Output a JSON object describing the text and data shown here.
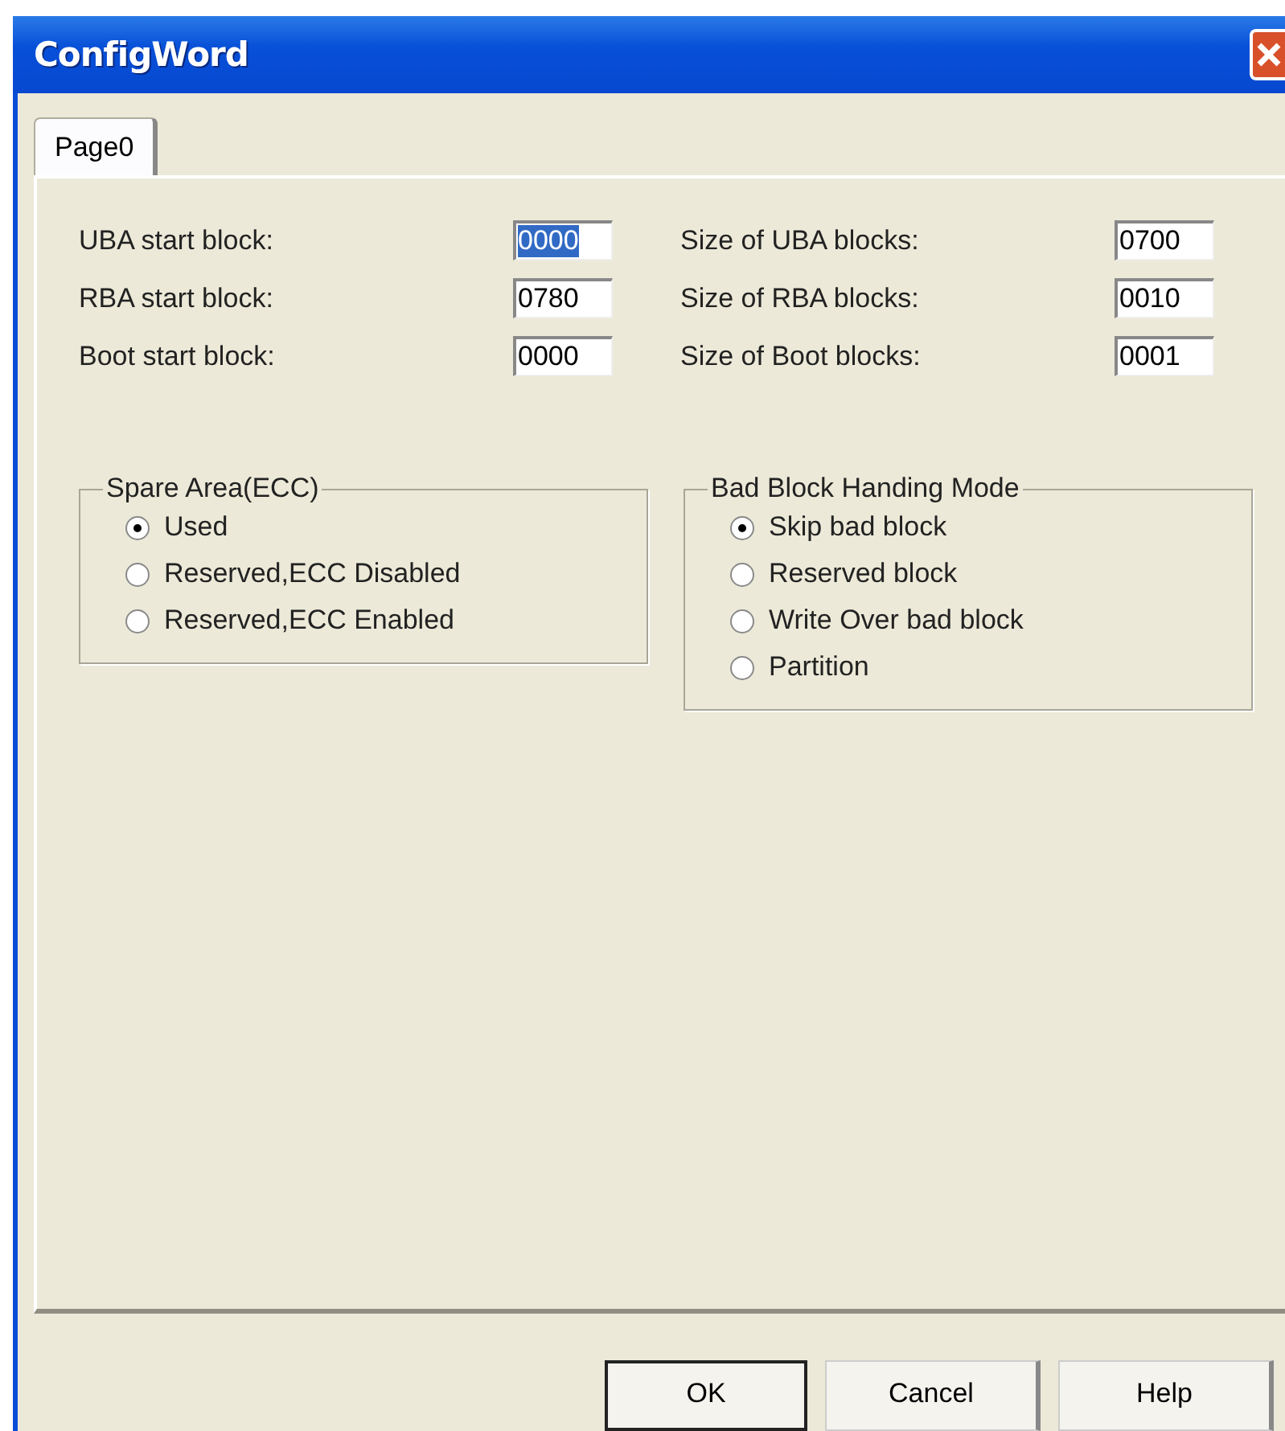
{
  "window": {
    "title": "ConfigWord"
  },
  "tabs": [
    {
      "label": "Page0",
      "selected": true
    }
  ],
  "fields_left": [
    {
      "label": "UBA start block:",
      "value": "0000",
      "text_selected": true
    },
    {
      "label": "RBA start block:",
      "value": "0780",
      "text_selected": false
    },
    {
      "label": "Boot start block:",
      "value": "0000",
      "text_selected": false
    }
  ],
  "fields_right": [
    {
      "label": "Size of UBA blocks:",
      "value": "0700",
      "text_selected": false
    },
    {
      "label": "Size of RBA blocks:",
      "value": "0010",
      "text_selected": false
    },
    {
      "label": "Size of Boot blocks:",
      "value": "0001",
      "text_selected": false
    }
  ],
  "groups": [
    {
      "title": "Spare Area(ECC)",
      "options": [
        {
          "label": "Used",
          "selected": true
        },
        {
          "label": "Reserved,ECC Disabled",
          "selected": false
        },
        {
          "label": "Reserved,ECC Enabled",
          "selected": false
        }
      ]
    },
    {
      "title": "Bad Block Handing Mode",
      "options": [
        {
          "label": "Skip bad block",
          "selected": true
        },
        {
          "label": "Reserved block",
          "selected": false
        },
        {
          "label": "Write Over bad block",
          "selected": false
        },
        {
          "label": "Partition",
          "selected": false
        }
      ]
    }
  ],
  "buttons": [
    {
      "label": "OK",
      "default": true
    },
    {
      "label": "Cancel",
      "default": false
    },
    {
      "label": "Help",
      "default": false
    }
  ]
}
